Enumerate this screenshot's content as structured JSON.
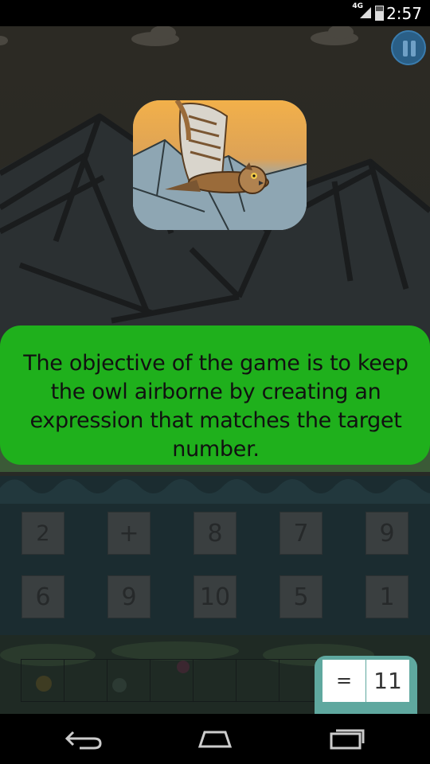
{
  "status_bar": {
    "network": "4G",
    "time": "2:57"
  },
  "tutorial": {
    "text": "The objective of the game is to keep the owl airborne by creating an expression that matches the target number."
  },
  "tiles": {
    "row1": [
      "2",
      "+",
      "8",
      "7",
      "9"
    ],
    "row2": [
      "6",
      "9",
      "10",
      "5",
      "1"
    ]
  },
  "target": {
    "operator": "=",
    "number": "11"
  },
  "icons": {
    "pause": "pause-icon",
    "back": "back-icon",
    "home": "home-icon",
    "recents": "recents-icon"
  },
  "colors": {
    "tutorial_bg": "#1fb01c",
    "pause_bg": "#2a5f87",
    "sky": "#2e2b22",
    "tile": "#3a3f40"
  }
}
